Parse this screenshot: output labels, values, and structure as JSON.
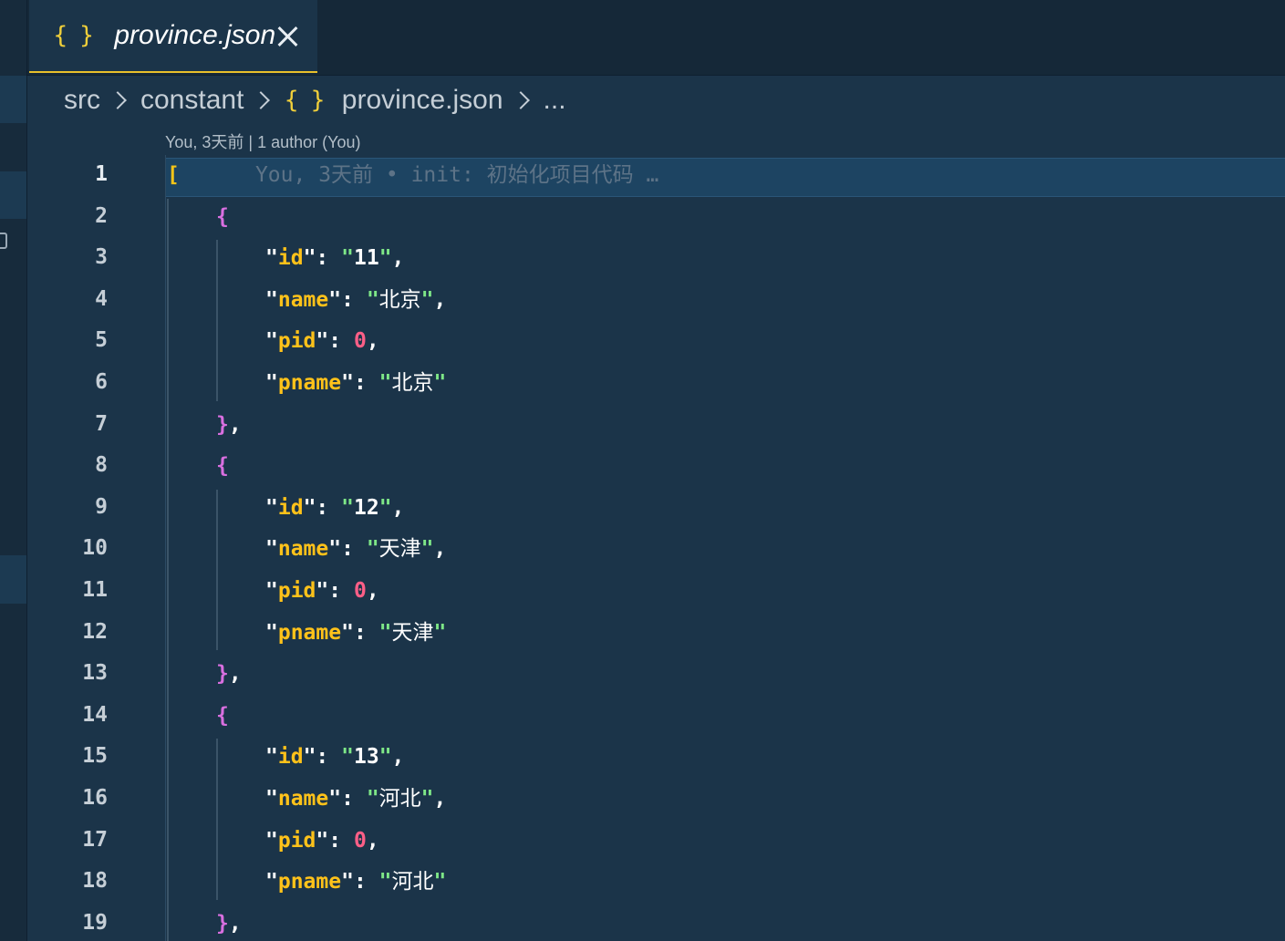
{
  "tab": {
    "icon": "json-braces-icon",
    "icon_glyph": "{ }",
    "label": "province.json"
  },
  "breadcrumb": {
    "items": [
      "src",
      "constant",
      "province.json"
    ],
    "json_icon_glyph": "{ }",
    "ellipsis": "..."
  },
  "codelens": "You, 3天前 | 1 author (You)",
  "blame_inline": "You, 3天前 • init: 初始化项目代码 …",
  "line_numbers": [
    "1",
    "2",
    "3",
    "4",
    "5",
    "6",
    "7",
    "8",
    "9",
    "10",
    "11",
    "12",
    "13",
    "14",
    "15",
    "16",
    "17",
    "18",
    "19"
  ],
  "code": {
    "open_bracket": "[",
    "records": [
      {
        "id": "11",
        "name": "北京",
        "pid": "0",
        "pname": "北京"
      },
      {
        "id": "12",
        "name": "天津",
        "pid": "0",
        "pname": "天津"
      },
      {
        "id": "13",
        "name": "河北",
        "pid": "0",
        "pname": "河北"
      }
    ],
    "keys": {
      "id": "id",
      "name": "name",
      "pid": "pid",
      "pname": "pname"
    },
    "brace_open": "{",
    "brace_close": "},"
  },
  "colors": {
    "editor_bg": "#1b3449",
    "tab_accent": "#e8c02b",
    "key": "#ffc21a",
    "number": "#ff5f87",
    "brace": "#d96fe0",
    "string_quote": "#7ee787"
  }
}
